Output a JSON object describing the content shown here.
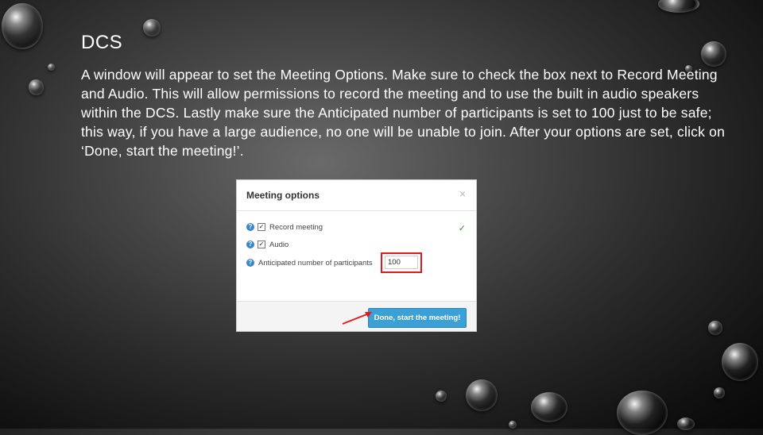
{
  "slide": {
    "title": "DCS",
    "body": "A window will appear to set the Meeting Options. Make sure to check the box next to Record Meeting and Audio. This will allow permissions to record the meeting and to use the built in audio speakers within the DCS. Lastly make sure the Anticipated number of participants is set to 100 just to be safe;  this way, if you have a large audience, no one will be unable to join. After your options are set, click on ‘Done, start the meeting!’."
  },
  "dialog": {
    "title": "Meeting options",
    "close_glyph": "×",
    "options": [
      {
        "label": "Record meeting",
        "checked": true
      },
      {
        "label": "Audio",
        "checked": true
      },
      {
        "label": "Anticipated number of participants"
      }
    ],
    "participants_value": "100",
    "help_glyph": "?",
    "check_glyph": "✓",
    "done_label": "Done, start the meeting!"
  },
  "colors": {
    "button": "#3aa0d6",
    "highlight": "#e01b1b",
    "help_icon": "#3a87c8"
  }
}
